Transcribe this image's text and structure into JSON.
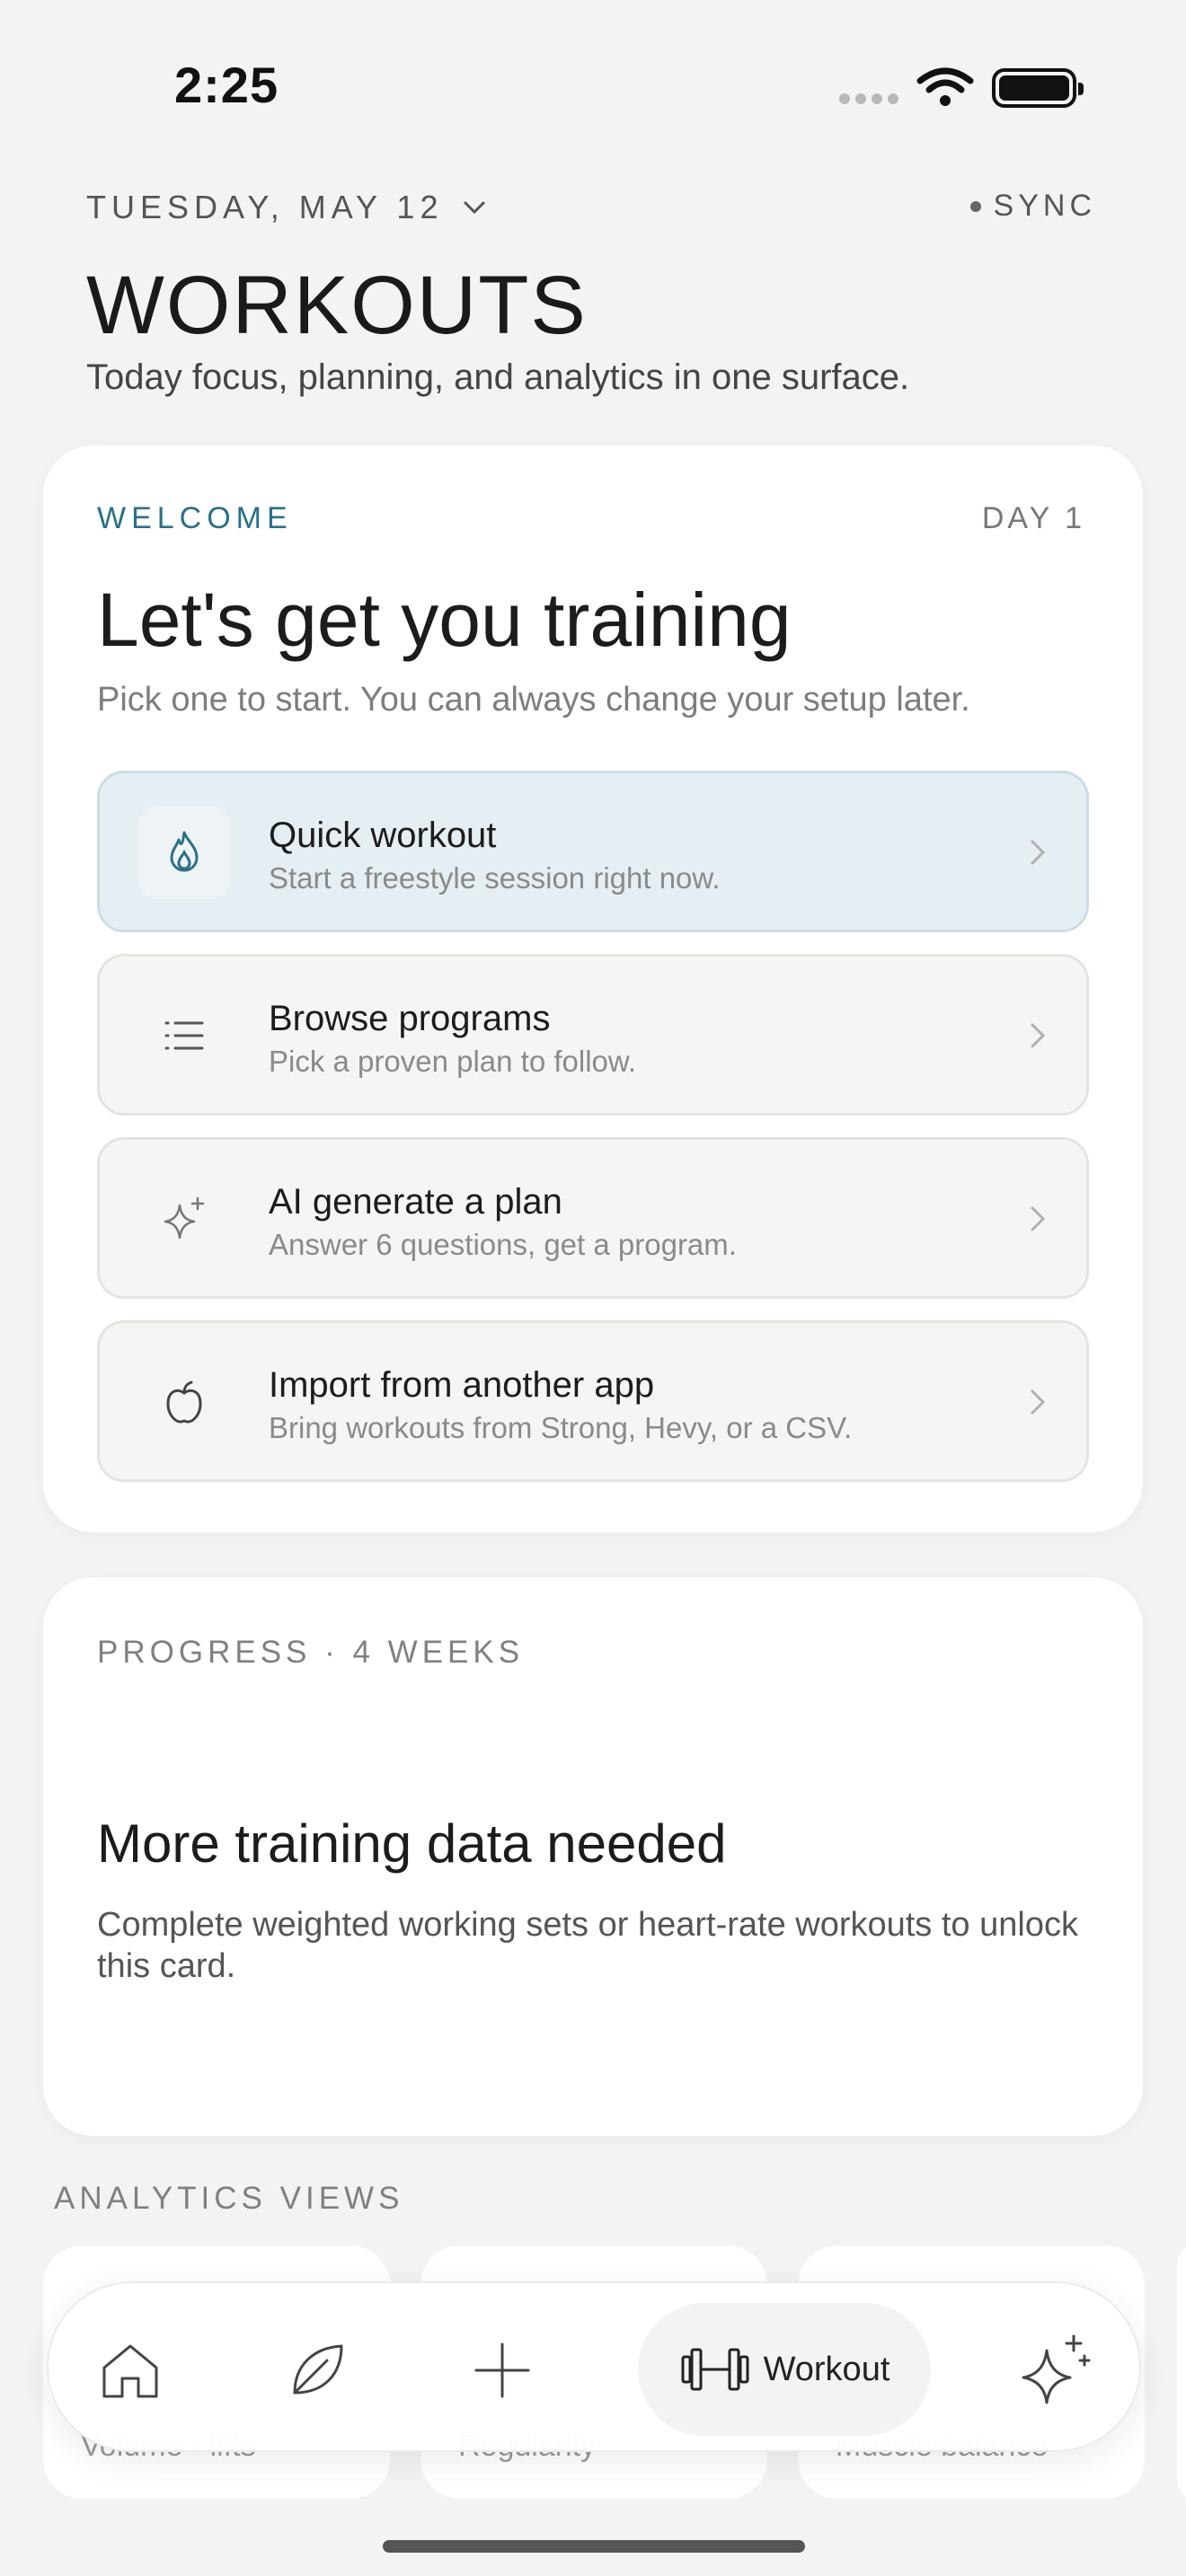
{
  "status_bar": {
    "time": "2:25"
  },
  "header": {
    "date": "TUESDAY, MAY 12",
    "sync": "SYNC",
    "title": "WORKOUTS",
    "subtitle": "Today focus, planning, and analytics in one surface."
  },
  "welcome": {
    "eyebrow": "WELCOME",
    "day": "DAY 1",
    "title": "Let's get you training",
    "subtitle": "Pick one to start. You can always change your setup later.",
    "options": [
      {
        "title": "Quick workout",
        "desc": "Start a freestyle session right now.",
        "icon": "flame-icon"
      },
      {
        "title": "Browse programs",
        "desc": "Pick a proven plan to follow.",
        "icon": "list-icon"
      },
      {
        "title": "AI generate a plan",
        "desc": "Answer 6 questions, get a program.",
        "icon": "sparkle-icon"
      },
      {
        "title": "Import from another app",
        "desc": "Bring workouts from Strong, Hevy, or a CSV.",
        "icon": "apple-icon"
      }
    ]
  },
  "progress": {
    "label": "PROGRESS · 4 WEEKS",
    "title": "More training data needed",
    "desc": "Complete weighted working sets or heart-rate workouts to unlock this card."
  },
  "analytics": {
    "label": "ANALYTICS VIEWS",
    "cards": [
      "Volume · lifts",
      "Regularity",
      "Muscle balance"
    ]
  },
  "tabbar": {
    "items": [
      "home-icon",
      "leaf-icon",
      "plus-icon",
      "dumbbell-icon",
      "sparkle-icon"
    ],
    "active_label": "Workout"
  },
  "colors": {
    "accent": "#2b6f86",
    "active_option_bg": "#e5eef3"
  }
}
